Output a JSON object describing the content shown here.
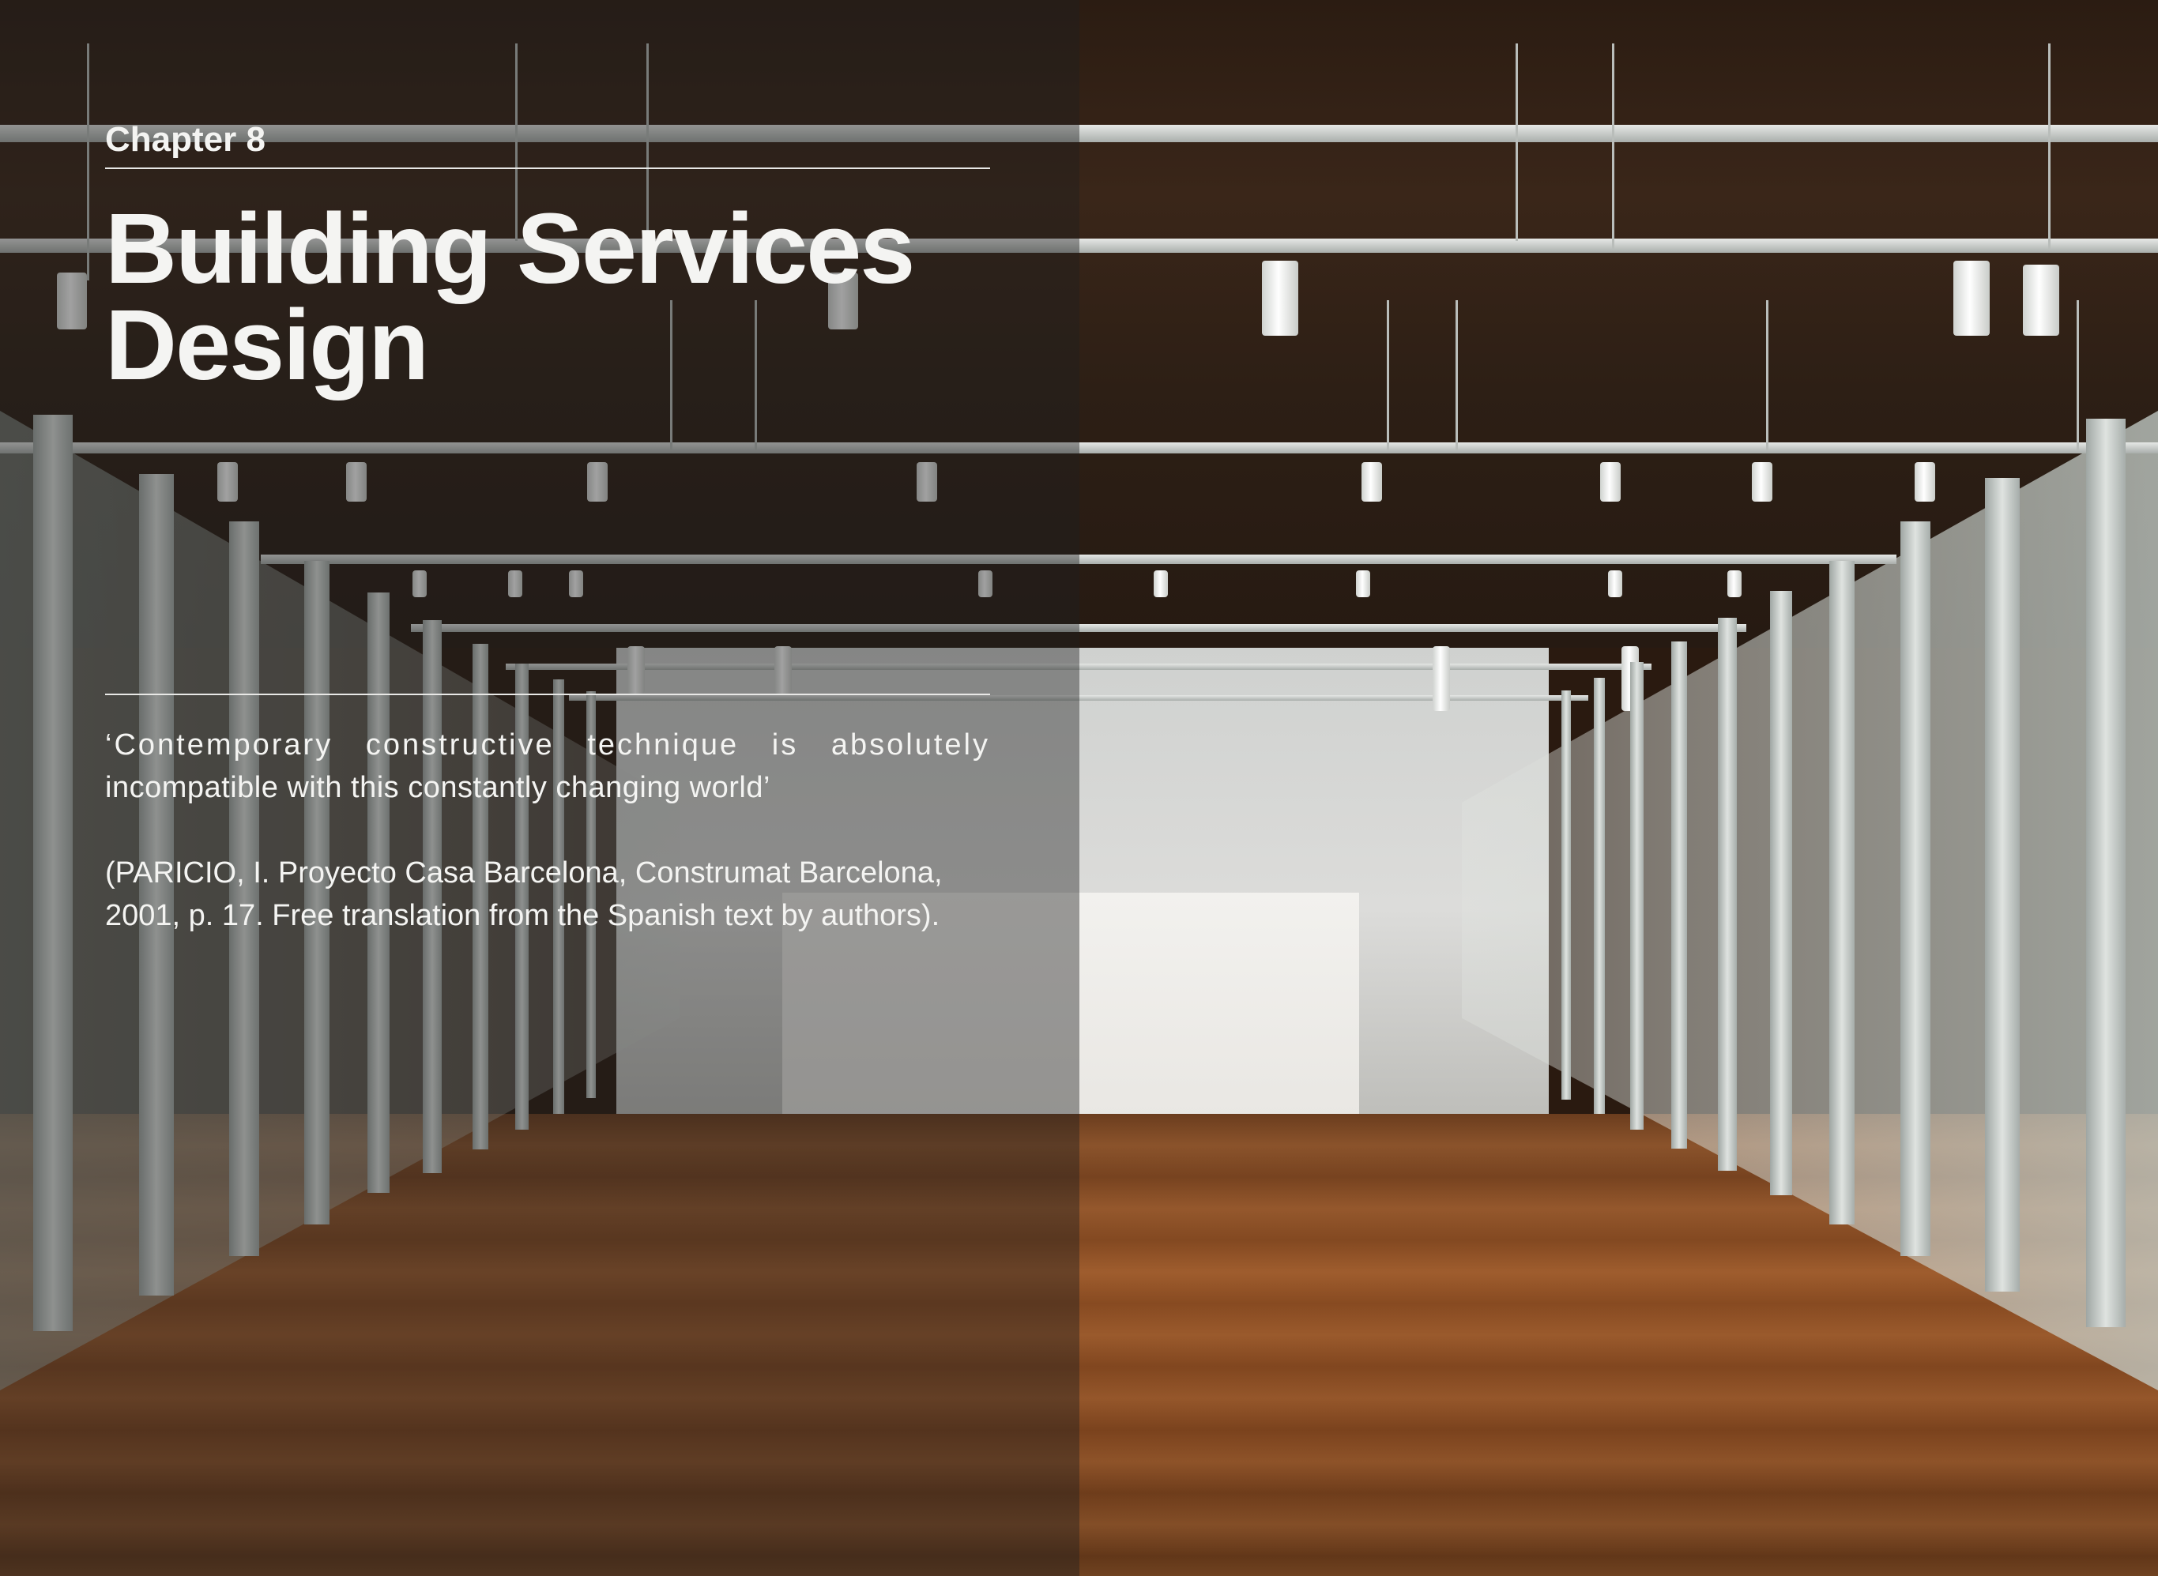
{
  "chapter": {
    "label": "Chapter 8"
  },
  "title": {
    "line1": "Building Services",
    "line2": "Design"
  },
  "quote": {
    "line1": "‘Contemporary constructive technique is absolutely",
    "line2": "incompatible with this constantly changing world’"
  },
  "citation": {
    "line1": "(PARICIO, I. Proyecto Casa Barcelona, Construmat Barcelona,",
    "line2": "2001, p. 17. Free translation from the Spanish text by authors)."
  },
  "colors": {
    "text": "#f4f4f2",
    "overlay": "rgba(30,30,30,0.42)",
    "ceiling": "#2b1c12",
    "floor": "#8a4c22"
  }
}
